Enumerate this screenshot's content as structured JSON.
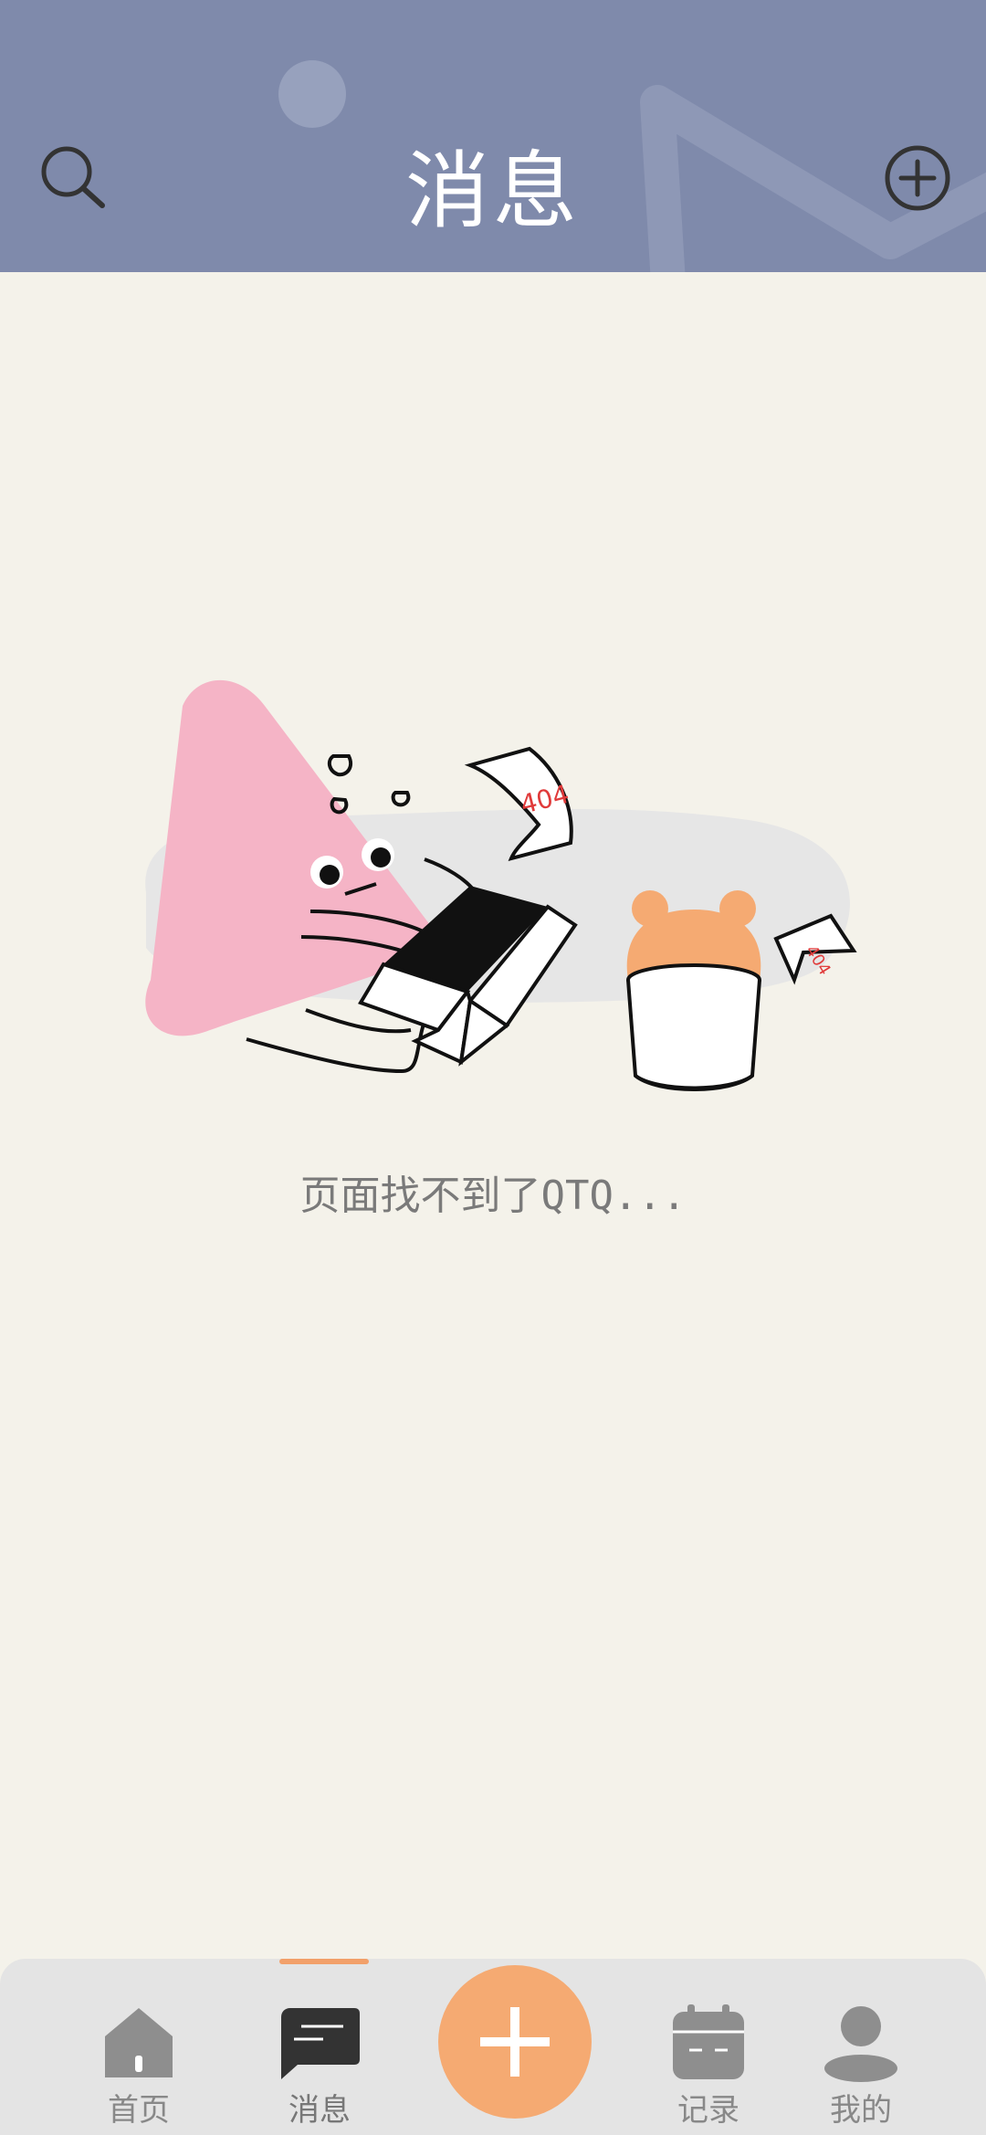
{
  "header": {
    "title": "消息",
    "left_icon": "search-icon",
    "right_icon": "add-circle-icon",
    "background_color": "#7f8aab"
  },
  "empty_state": {
    "illustration_labels": [
      "404",
      "404"
    ],
    "message": "页面找不到了QTQ...",
    "accent_color": "#f5aa72",
    "figure_color": "#f5b4c6"
  },
  "tabbar": {
    "items": [
      {
        "label": "首页",
        "icon": "home-icon",
        "active": false
      },
      {
        "label": "消息",
        "icon": "message-icon",
        "active": true
      },
      {
        "label": "",
        "icon": "plus-icon",
        "active": false
      },
      {
        "label": "记录",
        "icon": "calendar-icon",
        "active": false
      },
      {
        "label": "我的",
        "icon": "user-icon",
        "active": false
      }
    ],
    "center_button_color": "#f5aa72",
    "indicator_color": "#f2a06a"
  }
}
